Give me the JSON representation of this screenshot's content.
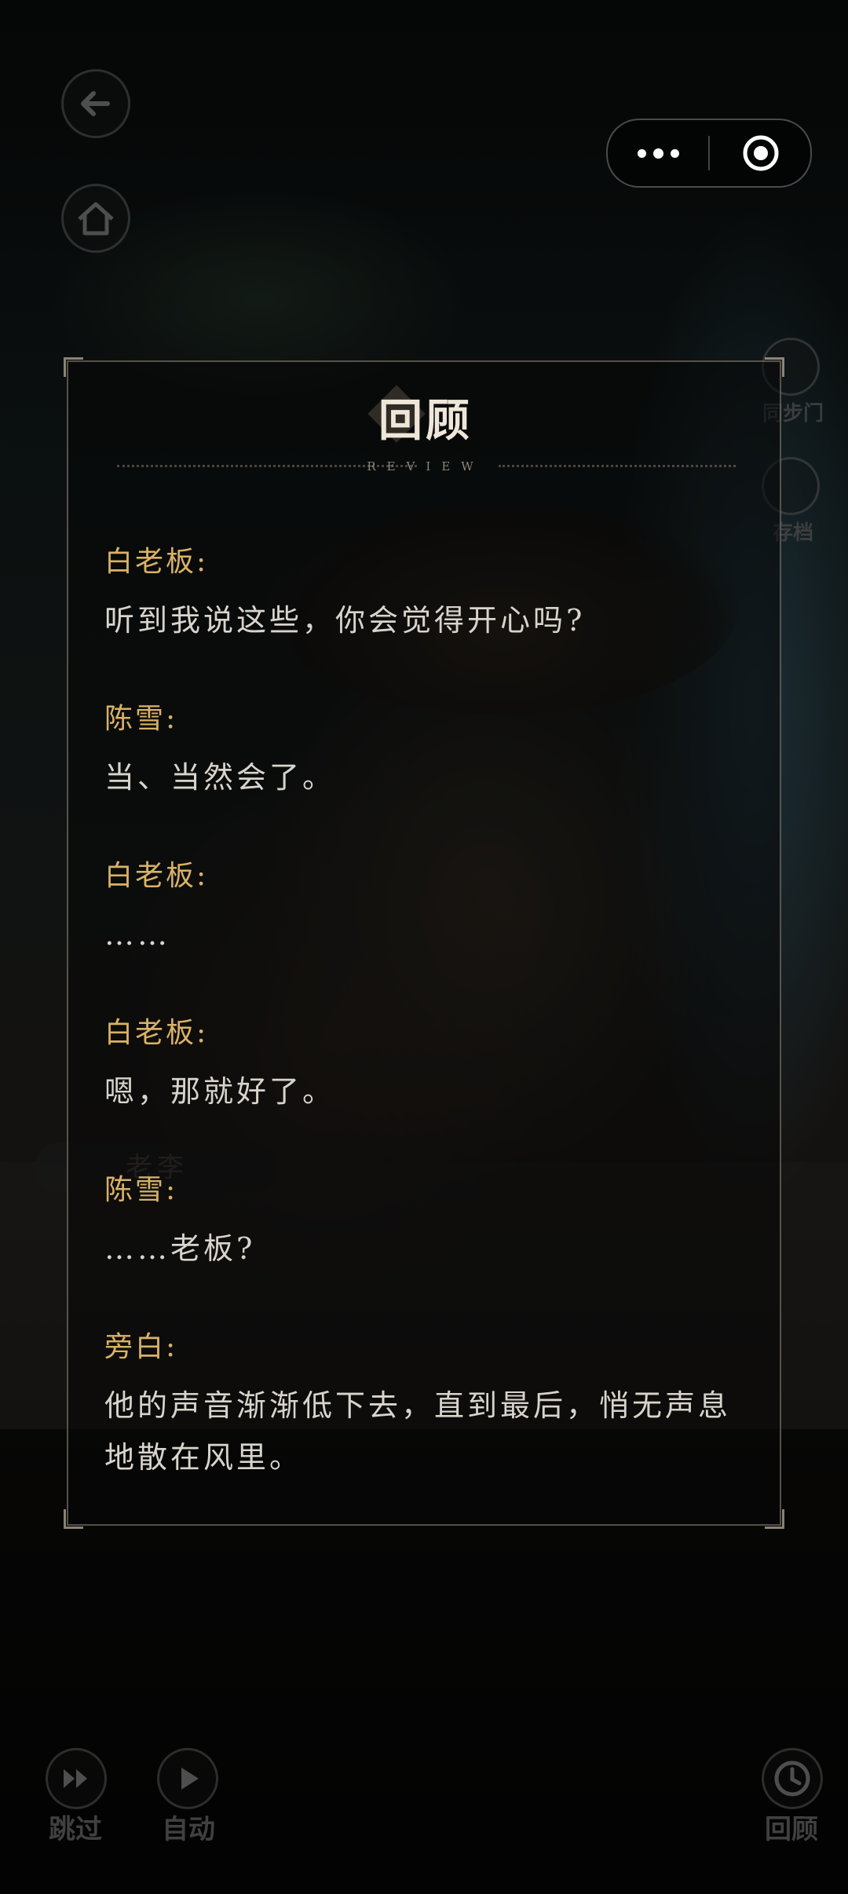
{
  "background": {
    "character_name_label": "老李"
  },
  "hud": {
    "back_icon": "back-arrow-icon",
    "home_icon": "home-icon",
    "right_button_1_label": "同步门",
    "right_button_2_label": "存档",
    "skip_label": "跳过",
    "auto_label": "自动",
    "review_label": "回顾"
  },
  "capsule": {
    "more_icon": "more-dots-icon",
    "close_icon": "target-circle-icon"
  },
  "review": {
    "title": "回顾",
    "subtitle": "REVIEW",
    "entries": [
      {
        "speaker": "白老板:",
        "text": "听到我说这些，你会觉得开心吗?"
      },
      {
        "speaker": "陈雪:",
        "text": "当、当然会了。"
      },
      {
        "speaker": "白老板:",
        "text": "……"
      },
      {
        "speaker": "白老板:",
        "text": "嗯，那就好了。"
      },
      {
        "speaker": "陈雪:",
        "text": "……老板?"
      },
      {
        "speaker": "旁白:",
        "text": "他的声音渐渐低下去，直到最后，悄无声息地散在风里。"
      }
    ]
  },
  "colors": {
    "speaker": "#d9b266",
    "text": "#d8d4cc",
    "panel_border": "#968c7d"
  }
}
